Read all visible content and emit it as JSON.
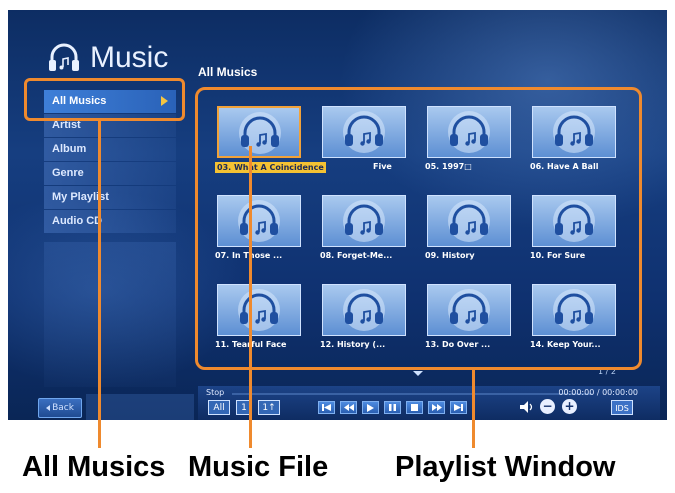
{
  "app": {
    "title": "Music",
    "section_title": "All Musics"
  },
  "sidebar": {
    "items": [
      {
        "label": "All Musics",
        "active": true
      },
      {
        "label": "Artist"
      },
      {
        "label": "Album"
      },
      {
        "label": "Genre"
      },
      {
        "label": "My Playlist"
      },
      {
        "label": "Audio CD"
      }
    ]
  },
  "back_button": {
    "label": "Back"
  },
  "grid": {
    "items": [
      {
        "label": "03. What A Coincidence",
        "selected": true
      },
      {
        "label": "Five"
      },
      {
        "label": "05. 1997□"
      },
      {
        "label": "06. Have A Ball"
      },
      {
        "label": "07. In Those ..."
      },
      {
        "label": "08. Forget-Me..."
      },
      {
        "label": "09. History"
      },
      {
        "label": "10. For Sure"
      },
      {
        "label": "11. Tearful Face"
      },
      {
        "label": "12. History (..."
      },
      {
        "label": "13. Do Over ..."
      },
      {
        "label": "14. Keep Your..."
      }
    ],
    "page_indicator": "1 / 2"
  },
  "player": {
    "status": "Stop",
    "time": "00:00:00 / 00:00:00",
    "progress": 0,
    "mode_buttons": [
      "All",
      "1",
      "1↑"
    ],
    "ids_label": "IDS",
    "volume_minus": "−",
    "volume_plus": "+"
  },
  "captions": {
    "all_musics": "All Musics",
    "music_file": "Music File",
    "playlist_window": "Playlist Window"
  },
  "colors": {
    "callout": "#ef8a2e",
    "highlight": "#f4c233",
    "background": "#163e80"
  }
}
